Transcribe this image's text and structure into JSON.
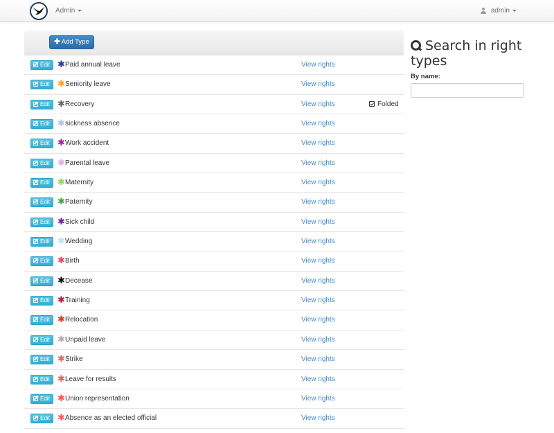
{
  "navbar": {
    "menu_label": "Admin",
    "user_label": "admin",
    "logo_icon": "swallow-bird-logo",
    "user_icon": "user-icon"
  },
  "toolbar": {
    "add_label": "Add Type",
    "add_icon": "plus-icon"
  },
  "types": [
    {
      "name": "Paid annual leave",
      "color": "#2b3c8c",
      "view_label": "View rights",
      "edit_label": "Edit",
      "folded_label": ""
    },
    {
      "name": "Seniority leave",
      "color": "#f5a11c",
      "view_label": "View rights",
      "edit_label": "Edit",
      "folded_label": ""
    },
    {
      "name": "Recovery",
      "color": "#666666",
      "view_label": "View rights",
      "edit_label": "Edit",
      "folded_label": "Folded"
    },
    {
      "name": "sickness absence",
      "color": "#b4c2ea",
      "view_label": "View rights",
      "edit_label": "Edit",
      "folded_label": ""
    },
    {
      "name": "Work accident",
      "color": "#9b1f9b",
      "view_label": "View rights",
      "edit_label": "Edit",
      "folded_label": ""
    },
    {
      "name": "Parental leave",
      "color": "#e3a8e3",
      "view_label": "View rights",
      "edit_label": "Edit",
      "folded_label": ""
    },
    {
      "name": "Maternity",
      "color": "#8ed16a",
      "view_label": "View rights",
      "edit_label": "Edit",
      "folded_label": ""
    },
    {
      "name": "Paternity",
      "color": "#3ea14a",
      "view_label": "View rights",
      "edit_label": "Edit",
      "folded_label": ""
    },
    {
      "name": "Sick child",
      "color": "#6b1f8a",
      "view_label": "View rights",
      "edit_label": "Edit",
      "folded_label": ""
    },
    {
      "name": "Wedding",
      "color": "#b8e6f2",
      "view_label": "View rights",
      "edit_label": "Edit",
      "folded_label": ""
    },
    {
      "name": "Birth",
      "color": "#e8456a",
      "view_label": "View rights",
      "edit_label": "Edit",
      "folded_label": ""
    },
    {
      "name": "Decease",
      "color": "#111111",
      "view_label": "View rights",
      "edit_label": "Edit",
      "folded_label": ""
    },
    {
      "name": "Training",
      "color": "#a31f3c",
      "view_label": "View rights",
      "edit_label": "Edit",
      "folded_label": ""
    },
    {
      "name": "Relocation",
      "color": "#e03a2e",
      "view_label": "View rights",
      "edit_label": "Edit",
      "folded_label": ""
    },
    {
      "name": "Unpaid leave",
      "color": "#b0b0b0",
      "view_label": "View rights",
      "edit_label": "Edit",
      "folded_label": ""
    },
    {
      "name": "Strike",
      "color": "#f05a5a",
      "view_label": "View rights",
      "edit_label": "Edit",
      "folded_label": ""
    },
    {
      "name": "Leave for results",
      "color": "#f05a5a",
      "view_label": "View rights",
      "edit_label": "Edit",
      "folded_label": ""
    },
    {
      "name": "Union representation",
      "color": "#f05a5a",
      "view_label": "View rights",
      "edit_label": "Edit",
      "folded_label": ""
    },
    {
      "name": "Absence as an elected official",
      "color": "#f05a5a",
      "view_label": "View rights",
      "edit_label": "Edit",
      "folded_label": ""
    }
  ],
  "search": {
    "title": "Search in right types",
    "by_name_label": "By name:",
    "input_value": "",
    "input_placeholder": "",
    "icon": "search-icon"
  }
}
